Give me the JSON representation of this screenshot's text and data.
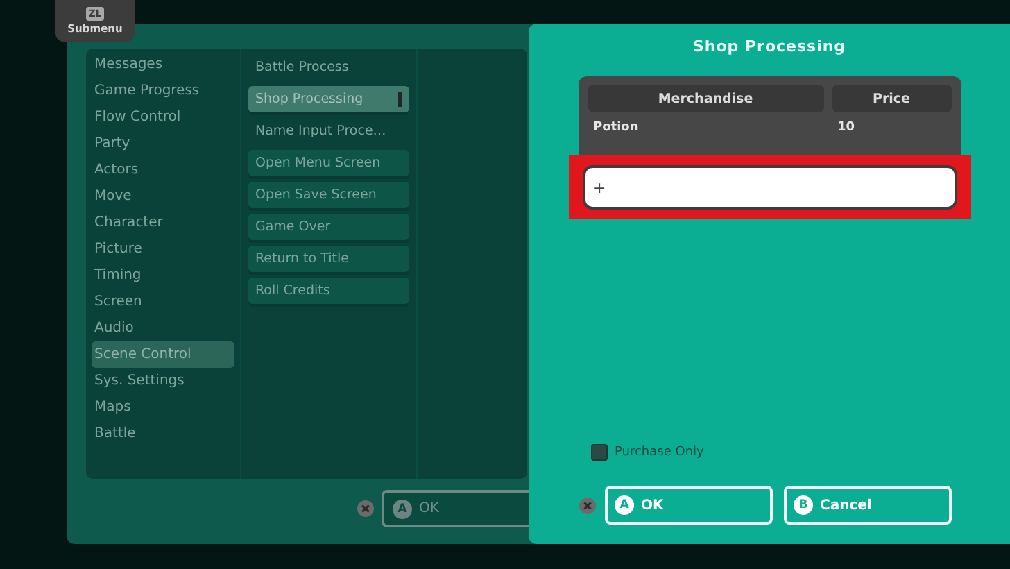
{
  "submenu_tab": {
    "key": "ZL",
    "label": "Submenu"
  },
  "left_dialog": {
    "categories": [
      {
        "label": "Messages",
        "selected": false
      },
      {
        "label": "Game Progress",
        "selected": false
      },
      {
        "label": "Flow Control",
        "selected": false
      },
      {
        "label": "Party",
        "selected": false
      },
      {
        "label": "Actors",
        "selected": false
      },
      {
        "label": "Move",
        "selected": false
      },
      {
        "label": "Character",
        "selected": false
      },
      {
        "label": "Picture",
        "selected": false
      },
      {
        "label": "Timing",
        "selected": false
      },
      {
        "label": "Screen",
        "selected": false
      },
      {
        "label": "Audio",
        "selected": false
      },
      {
        "label": "Scene Control",
        "selected": true
      },
      {
        "label": "Sys. Settings",
        "selected": false
      },
      {
        "label": "Maps",
        "selected": false
      },
      {
        "label": "Battle",
        "selected": false
      }
    ],
    "commands": [
      {
        "label": "Battle Process",
        "kind": "plain",
        "selected": false
      },
      {
        "label": "Shop Processing",
        "kind": "button",
        "selected": true
      },
      {
        "label": "Name Input Proce…",
        "kind": "plain",
        "selected": false
      },
      {
        "label": "Open Menu Screen",
        "kind": "button",
        "selected": false
      },
      {
        "label": "Open Save Screen",
        "kind": "button",
        "selected": false
      },
      {
        "label": "Game Over",
        "kind": "button",
        "selected": false
      },
      {
        "label": "Return to Title",
        "kind": "button",
        "selected": false
      },
      {
        "label": "Roll Credits",
        "kind": "button",
        "selected": false
      }
    ],
    "ok_button": {
      "key": "A",
      "label": "OK"
    }
  },
  "shop_dialog": {
    "title": "Shop Processing",
    "table": {
      "columns": [
        "Merchandise",
        "Price"
      ],
      "rows": [
        [
          "Potion",
          "10"
        ]
      ]
    },
    "add_field": {
      "value": "+"
    },
    "purchase_only": {
      "label": "Purchase Only",
      "checked": false
    },
    "buttons": [
      {
        "key": "A",
        "label": "OK"
      },
      {
        "key": "B",
        "label": "Cancel"
      }
    ]
  }
}
